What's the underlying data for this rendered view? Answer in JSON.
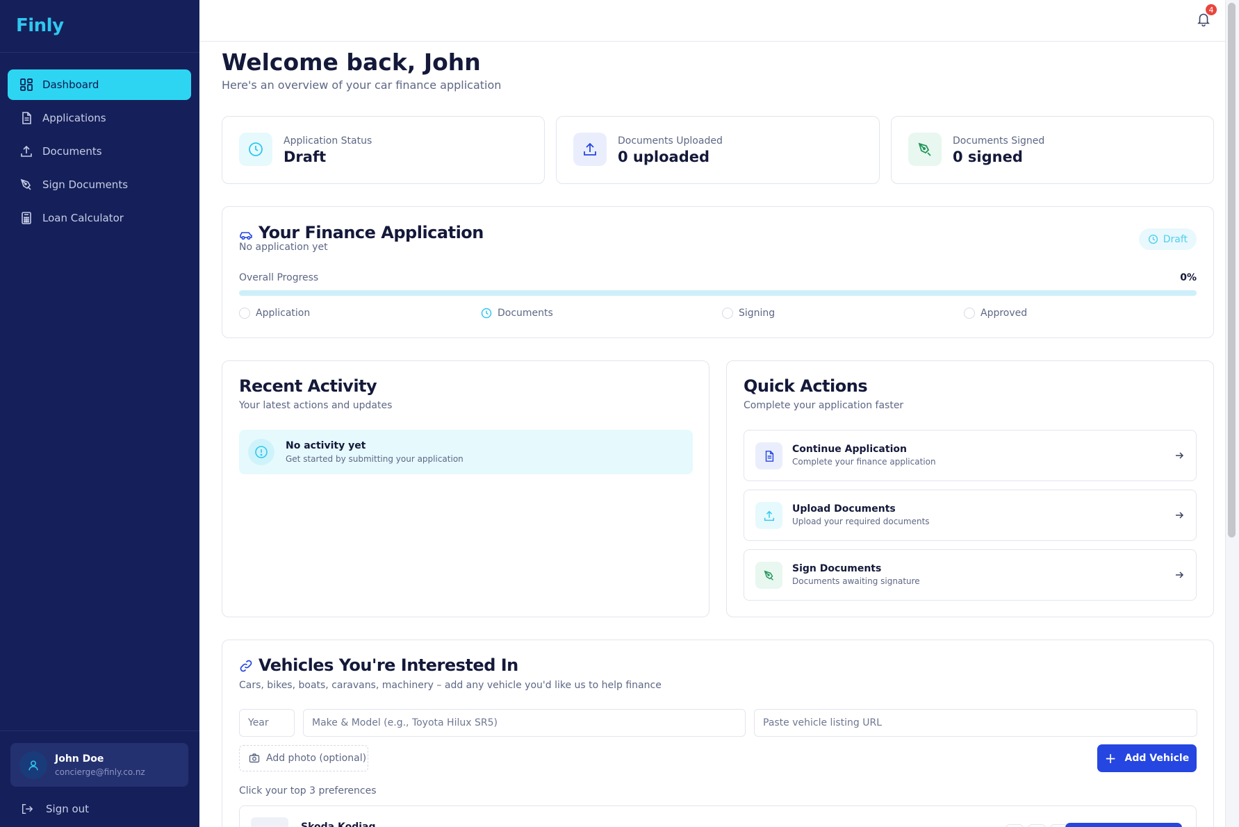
{
  "brand": {
    "name": "Finly",
    "accent": "#2dd5f3",
    "sidebar_bg": "#15205a",
    "primary": "#2546e0"
  },
  "sidebar": {
    "items": [
      {
        "label": "Dashboard",
        "icon": "dashboard-icon",
        "active": true
      },
      {
        "label": "Applications",
        "icon": "file-icon",
        "active": false
      },
      {
        "label": "Documents",
        "icon": "upload-icon",
        "active": false
      },
      {
        "label": "Sign Documents",
        "icon": "pen-icon",
        "active": false
      },
      {
        "label": "Loan Calculator",
        "icon": "calculator-icon",
        "active": false
      }
    ],
    "user": {
      "name": "John Doe",
      "email": "concierge@finly.co.nz"
    },
    "signout_label": "Sign out"
  },
  "topbar": {
    "notification_count": "4"
  },
  "header": {
    "title": "Welcome back, John",
    "subtitle": "Here's an overview of your car finance application"
  },
  "stats": [
    {
      "label": "Application Status",
      "value": "Draft",
      "icon": "clock-icon"
    },
    {
      "label": "Documents Uploaded",
      "value": "0 uploaded",
      "icon": "upload-icon"
    },
    {
      "label": "Documents Signed",
      "value": "0 signed",
      "icon": "pen-icon"
    }
  ],
  "finance": {
    "title": "Your Finance Application",
    "subtitle": "No application yet",
    "status_badge": "Draft",
    "progress_label": "Overall Progress",
    "progress_text": "0%",
    "progress_fraction": 0.0,
    "steps": [
      {
        "label": "Application",
        "state": "pending"
      },
      {
        "label": "Documents",
        "state": "current"
      },
      {
        "label": "Signing",
        "state": "pending"
      },
      {
        "label": "Approved",
        "state": "pending"
      }
    ]
  },
  "activity": {
    "title": "Recent Activity",
    "subtitle": "Your latest actions and updates",
    "empty_title": "No activity yet",
    "empty_sub": "Get started by submitting your application"
  },
  "quick_actions": {
    "title": "Quick Actions",
    "subtitle": "Complete your application faster",
    "items": [
      {
        "title": "Continue Application",
        "sub": "Complete your finance application",
        "icon": "document-icon"
      },
      {
        "title": "Upload Documents",
        "sub": "Upload your required documents",
        "icon": "upload-icon"
      },
      {
        "title": "Sign Documents",
        "sub": "Documents awaiting signature",
        "icon": "pen-icon"
      }
    ]
  },
  "vehicles": {
    "title": "Vehicles You're Interested In",
    "subtitle": "Cars, bikes, boats, caravans, machinery – add any vehicle you'd like us to help finance",
    "year_placeholder": "Year",
    "make_placeholder": "Make & Model (e.g., Toyota Hilux SR5)",
    "url_placeholder": "Paste vehicle listing URL",
    "photo_label": "Add photo (optional)",
    "add_label": "Add Vehicle",
    "prefs_label": "Click your top 3 preferences",
    "first_vehicle": "Skoda Kodiaq"
  }
}
